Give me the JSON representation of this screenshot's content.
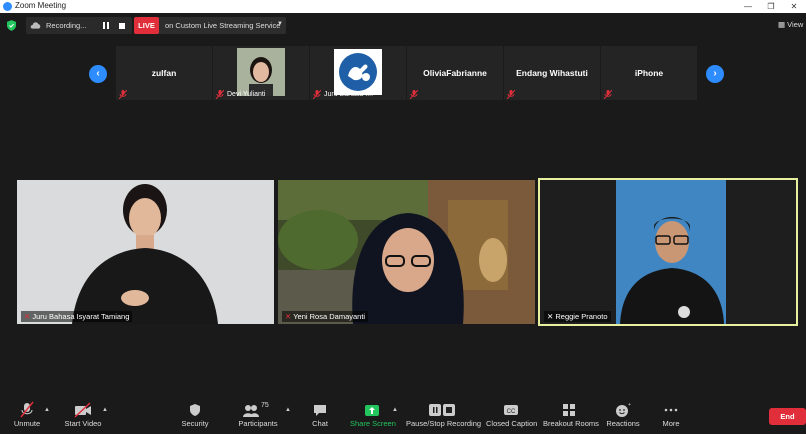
{
  "window": {
    "title": "Zoom Meeting",
    "minimize": "—",
    "restore": "❐",
    "close": "✕"
  },
  "topbar": {
    "recording_text": "Recording...",
    "live_badge": "LIVE",
    "live_text": "on Custom Live Streaming Service",
    "view_label": "View"
  },
  "strip": {
    "tiles": [
      {
        "name": "zulfan"
      },
      {
        "name": "Devi Yulianti"
      },
      {
        "name": "Juru Bahasa I..."
      },
      {
        "name": "OliviaFabrianne"
      },
      {
        "name": "Endang Wihastuti"
      },
      {
        "name": "iPhone"
      }
    ]
  },
  "videos": [
    {
      "name": "Juru Bahasa Isyarat Tamiang"
    },
    {
      "name": "Yeni Rosa Damayanti"
    },
    {
      "name": "Reggie Pranoto"
    }
  ],
  "toolbar": {
    "unmute": "Unmute",
    "start_video": "Start Video",
    "security": "Security",
    "participants": "Participants",
    "participants_count": "75",
    "chat": "Chat",
    "share_screen": "Share Screen",
    "pause_stop_recording": "Pause/Stop Recording",
    "closed_caption": "Closed Caption",
    "breakout_rooms": "Breakout Rooms",
    "reactions": "Reactions",
    "more": "More",
    "end": "End"
  },
  "colors": {
    "accent": "#2d8cff",
    "live": "#e02f3b",
    "share": "#23c55e",
    "active_speaker": "#e8f0a0"
  }
}
